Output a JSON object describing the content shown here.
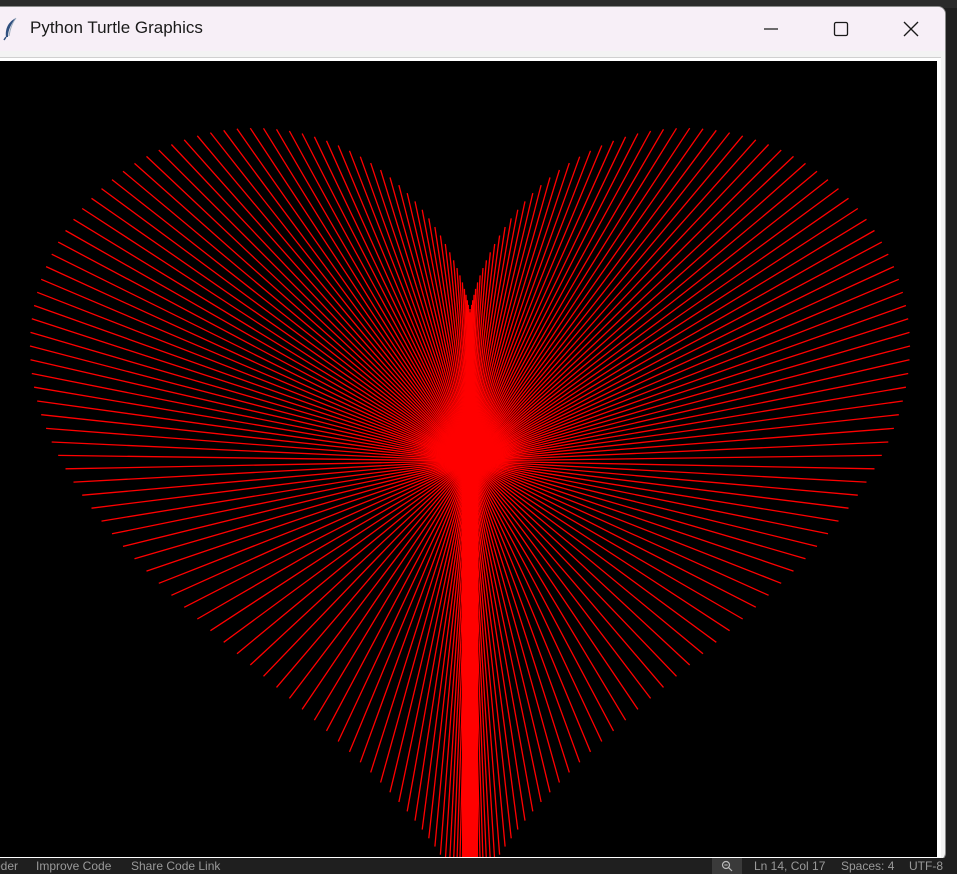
{
  "window": {
    "title": "Python Turtle Graphics",
    "controls": {
      "minimize": "minimize-icon",
      "maximize": "maximize-icon",
      "close": "close-icon"
    }
  },
  "canvas": {
    "background": "#000000",
    "pen_color": "#ff0000",
    "drawing": "heart made of radiating red lines"
  },
  "statusbar": {
    "coder": "oder",
    "improve": "Improve Code",
    "share": "Share Code Link",
    "position": "Ln 14, Col 17",
    "spaces": "Spaces: 4",
    "encoding": "UTF-8"
  }
}
